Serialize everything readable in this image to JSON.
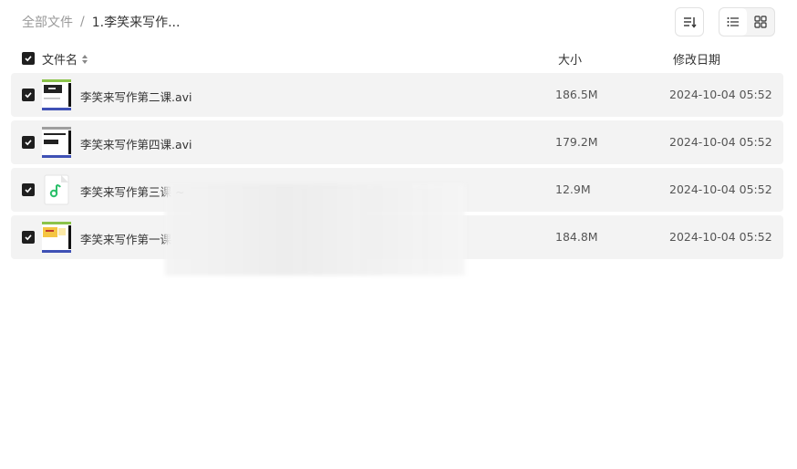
{
  "breadcrumb": {
    "root": "全部文件",
    "separator": "/",
    "current": "1.李笑来写作..."
  },
  "toolbar": {
    "sort_icon": "sort-icon",
    "list_view_icon": "list-view-icon",
    "grid_view_icon": "grid-view-icon"
  },
  "table": {
    "headers": {
      "name": "文件名",
      "size": "大小",
      "date": "修改日期"
    },
    "rows": [
      {
        "name": "李笑来写作第二课.avi",
        "size": "186.5M",
        "date": "2024-10-04 05:52",
        "type": "video",
        "checked": true
      },
      {
        "name": "李笑来写作第四课.avi",
        "size": "179.2M",
        "date": "2024-10-04 05:52",
        "type": "video",
        "checked": true
      },
      {
        "name": "李笑来写作第三课 ~",
        "size": "12.9M",
        "date": "2024-10-04 05:52",
        "type": "audio",
        "checked": true
      },
      {
        "name": "李笑来写作第一课",
        "size": "184.8M",
        "date": "2024-10-04 05:52",
        "type": "video",
        "checked": true
      }
    ]
  },
  "colors": {
    "row_bg": "#f3f3f3",
    "checkbox": "#1f1f1f",
    "audio_accent": "#2bbf6a"
  }
}
